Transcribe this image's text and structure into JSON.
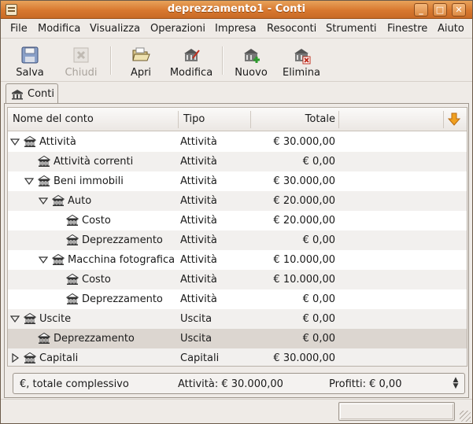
{
  "window": {
    "title": "deprezzamento1 - Conti"
  },
  "menubar": [
    "File",
    "Modifica",
    "Visualizza",
    "Operazioni",
    "Impresa",
    "Resoconti",
    "Strumenti",
    "Finestre",
    "Aiuto"
  ],
  "toolbar": {
    "save_label": "Salva",
    "close_label": "Chiudi",
    "open_label": "Apri",
    "edit_label": "Modifica",
    "new_label": "Nuovo",
    "delete_label": "Elimina"
  },
  "tab": {
    "label": "Conti"
  },
  "columns": {
    "name": "Nome del conto",
    "type": "Tipo",
    "total": "Totale"
  },
  "accounts": [
    {
      "name": "Attività",
      "type": "Attività",
      "total": "€ 30.000,00",
      "level": 0,
      "expander": "open"
    },
    {
      "name": "Attività correnti",
      "type": "Attività",
      "total": "€ 0,00",
      "level": 1,
      "expander": "none"
    },
    {
      "name": "Beni immobili",
      "type": "Attività",
      "total": "€ 30.000,00",
      "level": 1,
      "expander": "open"
    },
    {
      "name": "Auto",
      "type": "Attività",
      "total": "€ 20.000,00",
      "level": 2,
      "expander": "open"
    },
    {
      "name": "Costo",
      "type": "Attività",
      "total": "€ 20.000,00",
      "level": 3,
      "expander": "none"
    },
    {
      "name": "Deprezzamento",
      "type": "Attività",
      "total": "€ 0,00",
      "level": 3,
      "expander": "none"
    },
    {
      "name": "Macchina fotografica",
      "type": "Attività",
      "total": "€ 10.000,00",
      "level": 2,
      "expander": "open"
    },
    {
      "name": "Costo",
      "type": "Attività",
      "total": "€ 10.000,00",
      "level": 3,
      "expander": "none"
    },
    {
      "name": "Deprezzamento",
      "type": "Attività",
      "total": "€ 0,00",
      "level": 3,
      "expander": "none"
    },
    {
      "name": "Uscite",
      "type": "Uscita",
      "total": "€ 0,00",
      "level": 0,
      "expander": "open"
    },
    {
      "name": "Deprezzamento",
      "type": "Uscita",
      "total": "€ 0,00",
      "level": 1,
      "expander": "none",
      "selected": true
    },
    {
      "name": "Capitali",
      "type": "Capitali",
      "total": "€ 30.000,00",
      "level": 0,
      "expander": "closed"
    }
  ],
  "summary": {
    "currency": "€, totale complessivo",
    "assets": "Attività: € 30.000,00",
    "profits": "Profitti: € 0,00"
  }
}
